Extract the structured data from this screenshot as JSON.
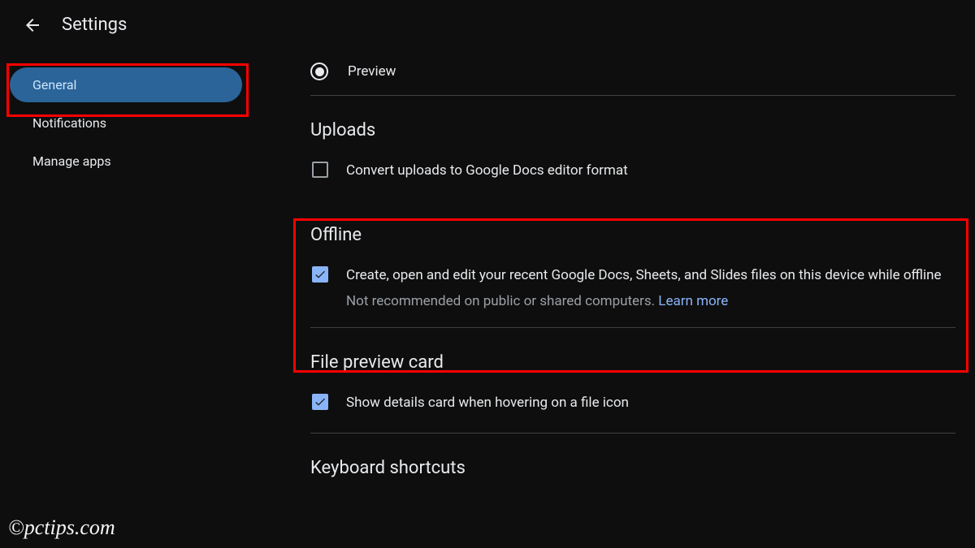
{
  "header": {
    "title": "Settings"
  },
  "sidebar": {
    "items": [
      {
        "label": "General",
        "active": true
      },
      {
        "label": "Notifications",
        "active": false
      },
      {
        "label": "Manage apps",
        "active": false
      }
    ]
  },
  "content": {
    "preview_label": "Preview",
    "uploads": {
      "title": "Uploads",
      "convert_label": "Convert uploads to Google Docs editor format",
      "convert_checked": false
    },
    "offline": {
      "title": "Offline",
      "label": "Create, open and edit your recent Google Docs, Sheets, and Slides files on this device while offline",
      "sub_prefix": "Not recommended on public or shared computers. ",
      "learn_more": "Learn more",
      "checked": true
    },
    "file_preview": {
      "title": "File preview card",
      "label": "Show details card when hovering on a file icon",
      "checked": true
    },
    "keyboard": {
      "title": "Keyboard shortcuts"
    }
  },
  "watermark": "©pctips.com"
}
